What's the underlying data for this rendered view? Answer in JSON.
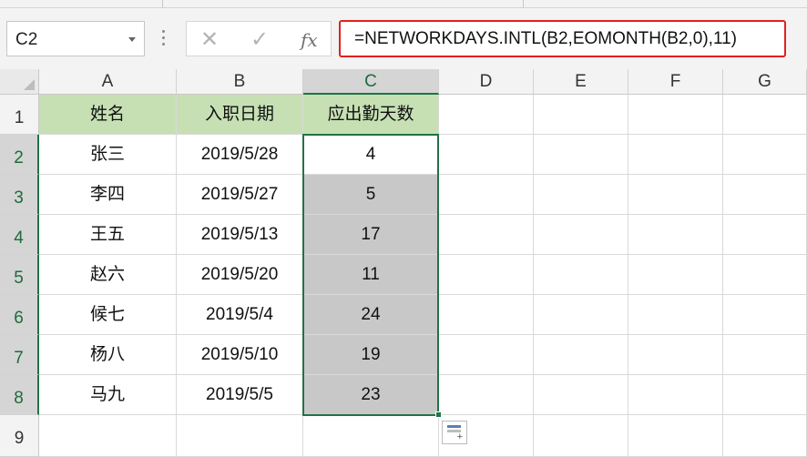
{
  "name_box": {
    "value": "C2"
  },
  "formula_bar": {
    "cancel_glyph": "✕",
    "enter_glyph": "✓",
    "fx_label": "fx",
    "formula": "=NETWORKDAYS.INTL(B2,EOMONTH(B2,0),11)",
    "highlight_color": "#e0211f"
  },
  "columns": [
    "A",
    "B",
    "C",
    "D",
    "E",
    "F",
    "G"
  ],
  "rows": [
    "1",
    "2",
    "3",
    "4",
    "5",
    "6",
    "7",
    "8",
    "9"
  ],
  "header_row": {
    "name": "姓名",
    "date": "入职日期",
    "days": "应出勤天数"
  },
  "data_rows": [
    {
      "name": "张三",
      "date": "2019/5/28",
      "days": "4"
    },
    {
      "name": "李四",
      "date": "2019/5/27",
      "days": "5"
    },
    {
      "name": "王五",
      "date": "2019/5/13",
      "days": "17"
    },
    {
      "name": "赵六",
      "date": "2019/5/20",
      "days": "11"
    },
    {
      "name": "候七",
      "date": "2019/5/4",
      "days": "24"
    },
    {
      "name": "杨八",
      "date": "2019/5/10",
      "days": "19"
    },
    {
      "name": "马九",
      "date": "2019/5/5",
      "days": "23"
    }
  ],
  "colors": {
    "header_fill": "#c6e0b4",
    "selected_fill": "#c8c8c8",
    "selection_border": "#217346"
  },
  "icons": [
    "dropdown-arrow-icon",
    "cancel-icon",
    "enter-icon",
    "fx-icon",
    "quick-analysis-icon"
  ]
}
